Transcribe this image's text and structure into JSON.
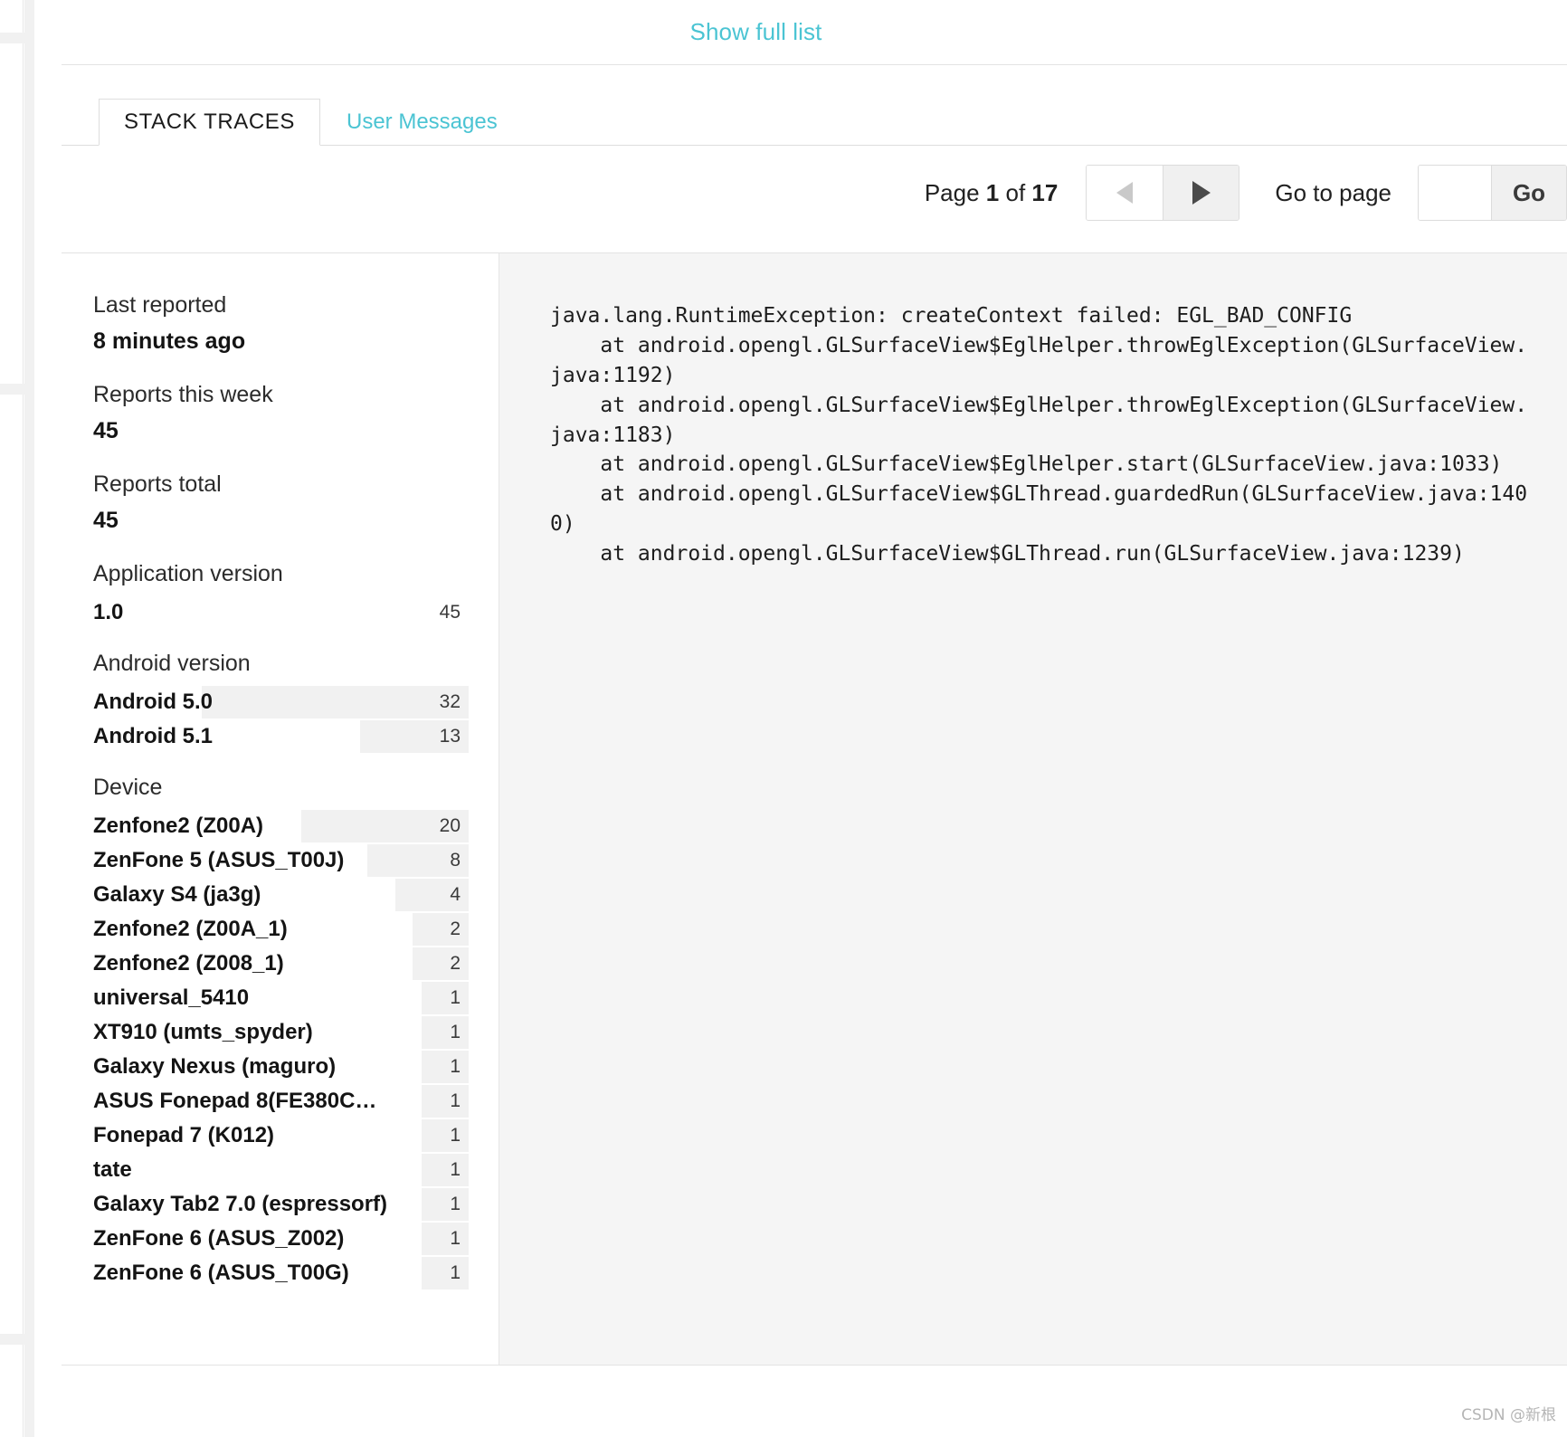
{
  "header": {
    "show_full_list_label": "Show full list"
  },
  "tabs": [
    {
      "label": "STACK TRACES",
      "active": true
    },
    {
      "label": "User Messages",
      "active": false
    }
  ],
  "pager": {
    "page_prefix": "Page",
    "current_page": "1",
    "of_word": "of",
    "total_pages": "17",
    "prev_icon": "triangle-left-icon",
    "next_icon": "triangle-right-icon",
    "goto_label": "Go to page",
    "goto_value": "",
    "goto_placeholder": "",
    "go_button_label": "Go"
  },
  "sidebar": {
    "stats": [
      {
        "label": "Last reported",
        "value": "8 minutes ago"
      },
      {
        "label": "Reports this week",
        "value": "45"
      },
      {
        "label": "Reports total",
        "value": "45"
      }
    ],
    "groups": [
      {
        "label": "Application version",
        "rows": [
          {
            "name": "1.0",
            "count": "45",
            "bar_pct": 0
          }
        ]
      },
      {
        "label": "Android version",
        "rows": [
          {
            "name": "Android 5.0",
            "count": "32",
            "bar_pct": 71
          },
          {
            "name": "Android 5.1",
            "count": "13",
            "bar_pct": 29
          }
        ]
      },
      {
        "label": "Device",
        "rows": [
          {
            "name": "Zenfone2 (Z00A)",
            "count": "20",
            "bar_pct": 44.5
          },
          {
            "name": "ZenFone 5 (ASUS_T00J)",
            "count": "8",
            "bar_pct": 27
          },
          {
            "name": "Galaxy S4 (ja3g)",
            "count": "4",
            "bar_pct": 19.5
          },
          {
            "name": "Zenfone2 (Z00A_1)",
            "count": "2",
            "bar_pct": 15
          },
          {
            "name": "Zenfone2 (Z008_1)",
            "count": "2",
            "bar_pct": 15
          },
          {
            "name": "universal_5410",
            "count": "1",
            "bar_pct": 12.5
          },
          {
            "name": "XT910 (umts_spyder)",
            "count": "1",
            "bar_pct": 12.5
          },
          {
            "name": "Galaxy Nexus (maguro)",
            "count": "1",
            "bar_pct": 12.5
          },
          {
            "name": "ASUS Fonepad 8(FE380C…",
            "count": "1",
            "bar_pct": 12.5
          },
          {
            "name": "Fonepad 7 (K012)",
            "count": "1",
            "bar_pct": 12.5
          },
          {
            "name": "tate",
            "count": "1",
            "bar_pct": 12.5
          },
          {
            "name": "Galaxy Tab2 7.0 (espressorf)",
            "count": "1",
            "bar_pct": 12.5
          },
          {
            "name": "ZenFone 6 (ASUS_Z002)",
            "count": "1",
            "bar_pct": 12.5
          },
          {
            "name": "ZenFone 6 (ASUS_T00G)",
            "count": "1",
            "bar_pct": 12.5
          }
        ]
      }
    ]
  },
  "stack_trace": {
    "text": "java.lang.RuntimeException: createContext failed: EGL_BAD_CONFIG\n    at android.opengl.GLSurfaceView$EglHelper.throwEglException(GLSurfaceView.java:1192)\n    at android.opengl.GLSurfaceView$EglHelper.throwEglException(GLSurfaceView.java:1183)\n    at android.opengl.GLSurfaceView$EglHelper.start(GLSurfaceView.java:1033)\n    at android.opengl.GLSurfaceView$GLThread.guardedRun(GLSurfaceView.java:1400)\n    at android.opengl.GLSurfaceView$GLThread.run(GLSurfaceView.java:1239)"
  },
  "watermark": {
    "text": "CSDN @新根"
  },
  "colors": {
    "accent": "#4bc4d3",
    "bar_fill": "#f1f1f1",
    "trace_bg": "#f5f5f5",
    "divider": "#e3e3e3"
  }
}
